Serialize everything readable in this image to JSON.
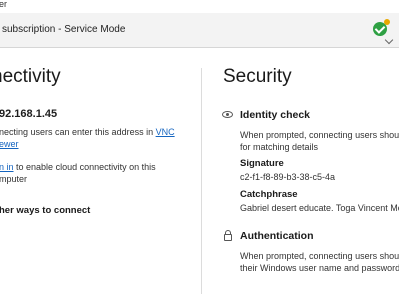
{
  "window": {
    "title": "er"
  },
  "header": {
    "subtitle": "subscription - Service Mode"
  },
  "left": {
    "title": "nectivity",
    "ip": "92.168.1.45",
    "desc_line1_prefix": "necting users can enter this address in",
    "desc_line1_link": "VNC",
    "desc_line2_link": "ewer",
    "signin_link": "n in",
    "signin_text": "to enable cloud connectivity on this",
    "signin_line2": "mputer",
    "other_ways": "her ways to connect"
  },
  "right": {
    "title": "Security",
    "identity": {
      "heading": "Identity check",
      "desc_line1": "When prompted, connecting users should",
      "desc_line2": "for matching details",
      "signature_label": "Signature",
      "signature_value": "c2-f1-f8-89-b3-38-c5-4a",
      "catchphrase_label": "Catchphrase",
      "catchphrase_value": "Gabriel desert educate. Toga Vincent Mor"
    },
    "auth": {
      "heading": "Authentication",
      "desc_line1": "When prompted, connecting users should",
      "desc_line2": "their Windows user name and password."
    }
  },
  "icons": {
    "status": "check-circle-icon",
    "warning": "warning-dot-icon",
    "chevron": "chevron-down-icon",
    "eye": "eye-icon",
    "lock": "lock-icon"
  },
  "colors": {
    "status_green": "#2ea043",
    "link": "#1565c0"
  }
}
